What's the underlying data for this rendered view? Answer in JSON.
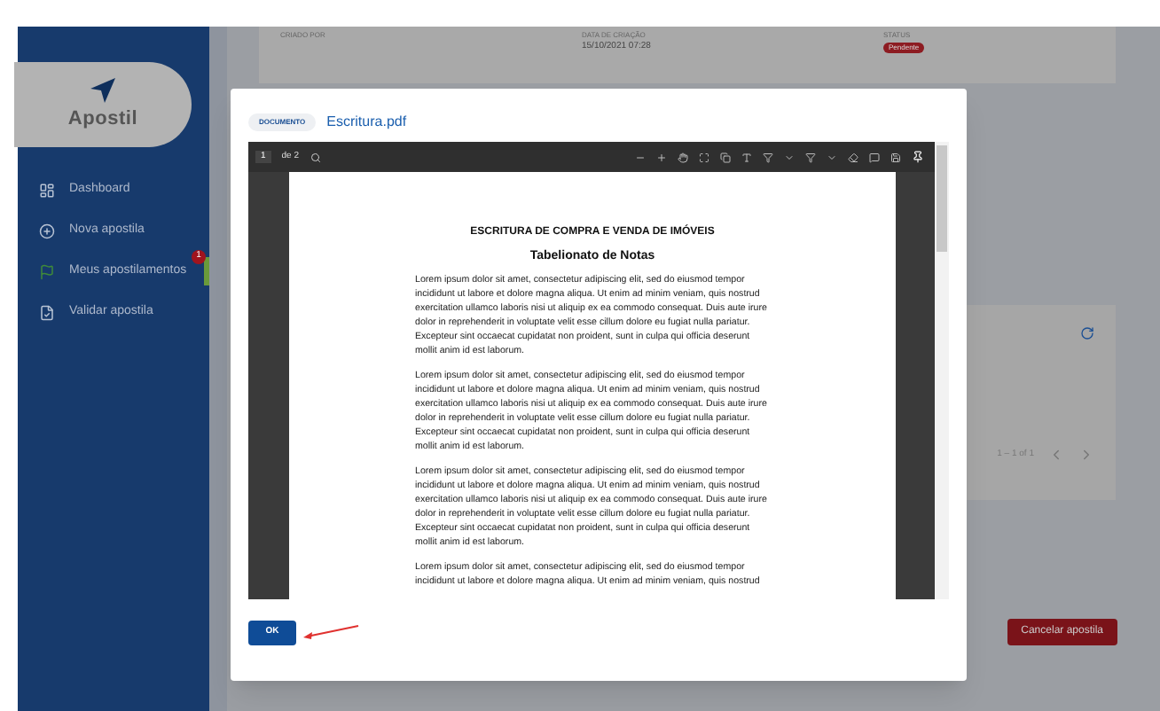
{
  "sidebar": {
    "logo": "Apostil",
    "items": [
      {
        "label": "Dashboard",
        "kind": "dashboard",
        "selected": false
      },
      {
        "label": "Nova apostila",
        "kind": "new",
        "selected": false
      },
      {
        "label": "Meus apostilamentos",
        "kind": "list",
        "selected": true,
        "badge": "1"
      },
      {
        "label": "Validar apostila",
        "kind": "validate",
        "selected": false
      }
    ]
  },
  "details": [
    {
      "label": "CRIADO POR"
    },
    {
      "label": "DATA DE CRIAÇÃO",
      "value": "15/10/2021 07:28"
    },
    {
      "label": "STATUS",
      "badge": "Pendente"
    }
  ],
  "pagination": {
    "range": "1 – 1 of 1"
  },
  "cancel_button": "Cancelar apostila",
  "modal": {
    "tag": "DOCUMENTO",
    "file_name": "Escritura.pdf",
    "viewer": {
      "page": "1",
      "page_count": "de 2"
    },
    "document": {
      "title": "ESCRITURA DE COMPRA E VENDA DE IMÓVEIS",
      "subtitle": "Tabelionato de Notas",
      "paragraphs": [
        "Lorem ipsum dolor sit amet, consectetur adipiscing elit, sed do eiusmod tempor incididunt ut labore et dolore magna aliqua. Ut enim ad minim veniam, quis nostrud exercitation ullamco laboris nisi ut aliquip ex ea commodo consequat. Duis aute irure dolor in reprehenderit in voluptate velit esse cillum dolore eu fugiat nulla pariatur. Excepteur sint occaecat cupidatat non proident, sunt in culpa qui officia deserunt mollit anim id est laborum.",
        "Lorem ipsum dolor sit amet, consectetur adipiscing elit, sed do eiusmod tempor incididunt ut labore et dolore magna aliqua. Ut enim ad minim veniam, quis nostrud exercitation ullamco laboris nisi ut aliquip ex ea commodo consequat. Duis aute irure dolor in reprehenderit in voluptate velit esse cillum dolore eu fugiat nulla pariatur. Excepteur sint occaecat cupidatat non proident, sunt in culpa qui officia deserunt mollit anim id est laborum.",
        "Lorem ipsum dolor sit amet, consectetur adipiscing elit, sed do eiusmod tempor incididunt ut labore et dolore magna aliqua. Ut enim ad minim veniam, quis nostrud exercitation ullamco laboris nisi ut aliquip ex ea commodo consequat. Duis aute irure dolor in reprehenderit in voluptate velit esse cillum dolore eu fugiat nulla pariatur. Excepteur sint occaecat cupidatat non proident, sunt in culpa qui officia deserunt mollit anim id est laborum.",
        "Lorem ipsum dolor sit amet, consectetur adipiscing elit, sed do eiusmod tempor incididunt ut labore et dolore magna aliqua. Ut enim ad minim veniam, quis nostrud"
      ]
    },
    "ok_button": "OK"
  }
}
